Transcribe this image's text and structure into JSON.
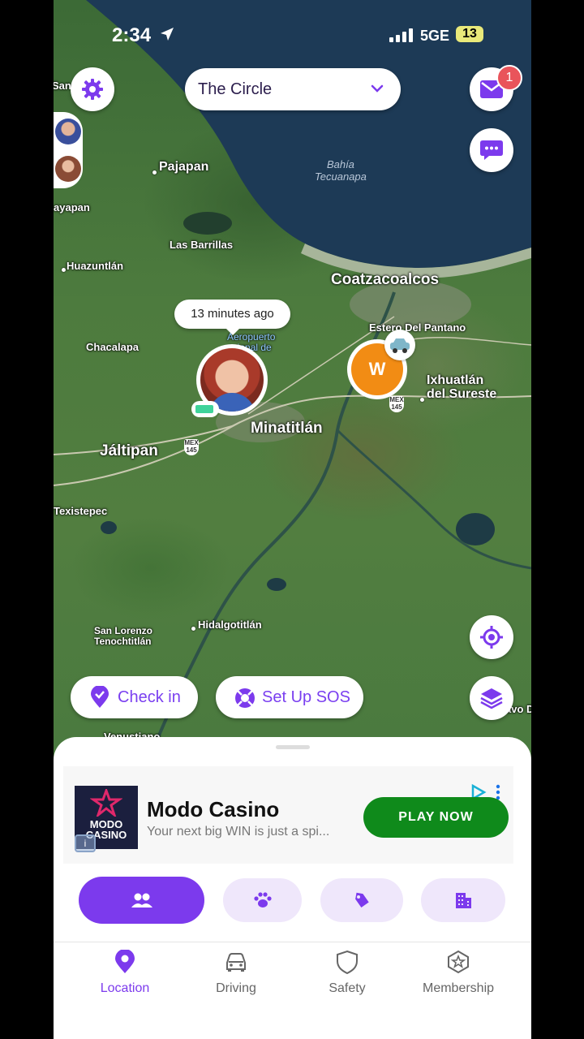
{
  "status_bar": {
    "time": "2:34",
    "network": "5GE",
    "battery": "13"
  },
  "header": {
    "circle_name": "The Circle",
    "message_badge": "1"
  },
  "map": {
    "labels": {
      "pajapan": "Pajapan",
      "bahia": "Bahía\nTecuanapa",
      "ayapan": "ayapan",
      "san": "San",
      "las_barrillas": "Las Barrillas",
      "huazuntlan": "Huazuntlán",
      "coatzacoalcos": "Coatzacoalcos",
      "estero": "Estero Del Pantano",
      "chacalapa": "Chacalapa",
      "aeropuerto": "Aeropuerto\nacional de\n(MTT)",
      "ixhuatlan": "Ixhuatlán\ndel Sureste",
      "minatitlan": "Minatitlán",
      "jaltipan": "Jáltipan",
      "texistepec": "Texistepec",
      "san_lorenzo": "San Lorenzo\nTenochtitlán",
      "hidalgotitlan": "Hidalgotitlán",
      "vo_d": "avo D",
      "venustiano": "Venustiano"
    },
    "time_bubble": "13 minutes ago",
    "member_initial": "W"
  },
  "actions": {
    "check_in": "Check in",
    "sos": "Set Up SOS"
  },
  "ad": {
    "logo_text": "MODO\nCASINO",
    "title": "Modo Casino",
    "subtitle": "Your next big WIN is just a spi...",
    "cta": "PLAY NOW"
  },
  "nav": {
    "location": "Location",
    "driving": "Driving",
    "safety": "Safety",
    "membership": "Membership"
  },
  "colors": {
    "accent": "#7c3aed",
    "orange": "#f28c14",
    "ad_green": "#0f8a1b"
  }
}
